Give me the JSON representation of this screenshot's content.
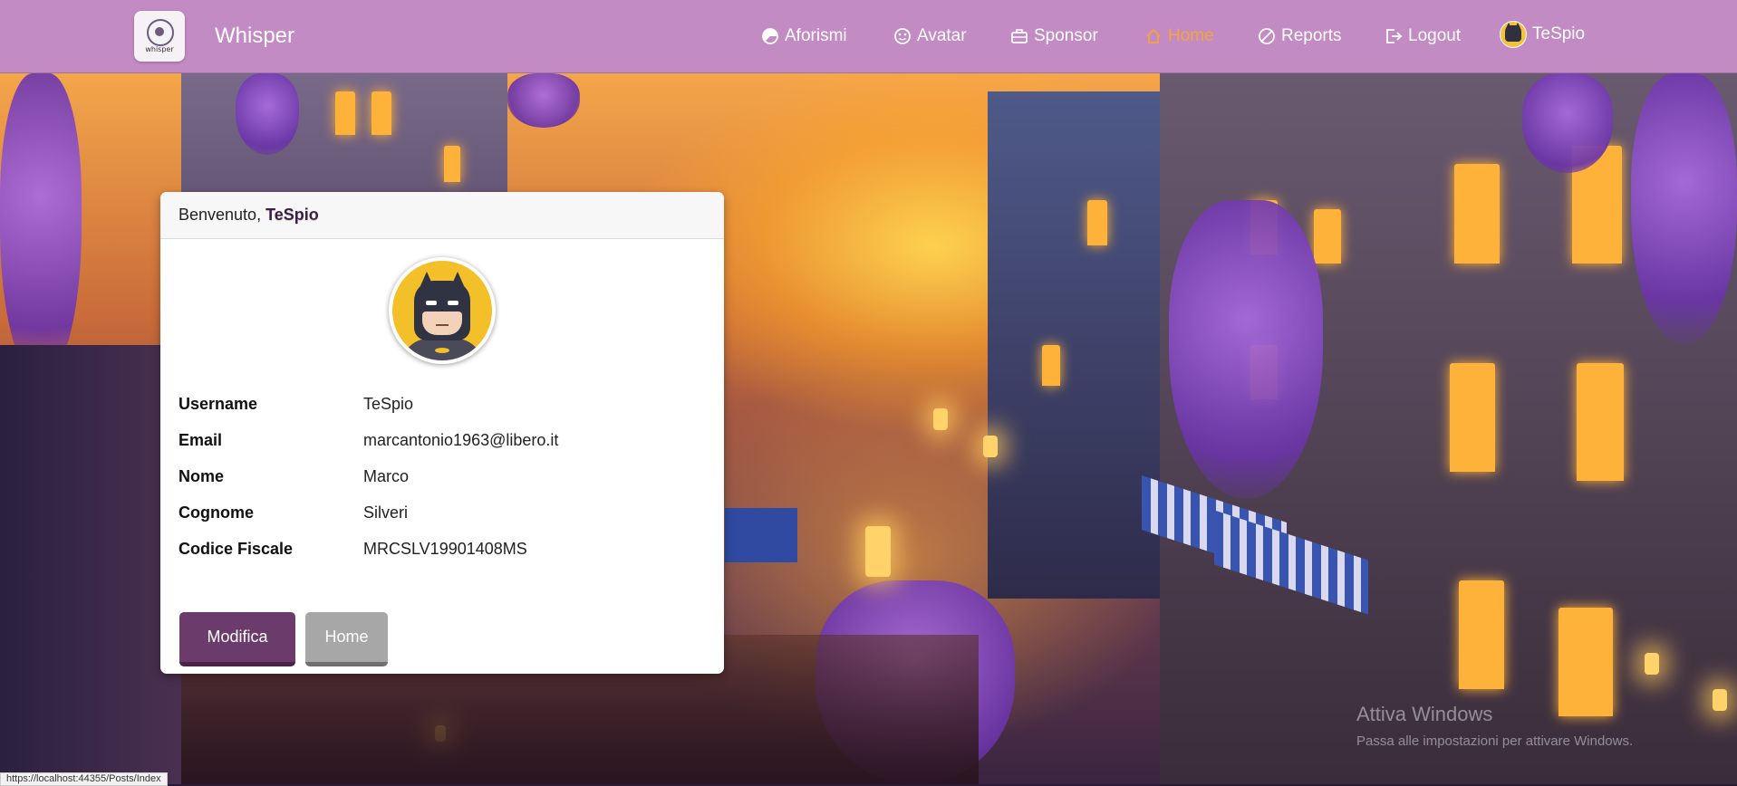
{
  "navbar": {
    "brand_name": "Whisper",
    "logo_text": "whisper",
    "items": [
      {
        "label": "Aforismi",
        "icon": "pie-chart-icon"
      },
      {
        "label": "Avatar",
        "icon": "face-icon"
      },
      {
        "label": "Sponsor",
        "icon": "briefcase-icon"
      },
      {
        "label": "Home",
        "icon": "home-icon",
        "active": true
      },
      {
        "label": "Reports",
        "icon": "slash-circle-icon"
      },
      {
        "label": "Logout",
        "icon": "logout-icon"
      }
    ],
    "user": {
      "label": "TeSpio",
      "icon": "batman-avatar-icon"
    },
    "active_color": "#f5a43a",
    "background_color": "#c38bc4"
  },
  "card": {
    "greeting": "Benvenuto,",
    "username": "TeSpio",
    "fields": [
      {
        "label": "Username",
        "value": "TeSpio"
      },
      {
        "label": "Email",
        "value": "marcantonio1963@libero.it"
      },
      {
        "label": "Nome",
        "value": "Marco"
      },
      {
        "label": "Cognome",
        "value": "Silveri"
      },
      {
        "label": "Codice Fiscale",
        "value": "MRCSLV19901408MS"
      }
    ],
    "buttons": {
      "modifica": "Modifica",
      "home": "Home"
    },
    "primary_color": "#6b3b6b"
  },
  "watermark": {
    "title": "Attiva Windows",
    "subtitle": "Passa alle impostazioni per attivare Windows."
  },
  "status_bar_url": "https://localhost:44355/Posts/Index"
}
